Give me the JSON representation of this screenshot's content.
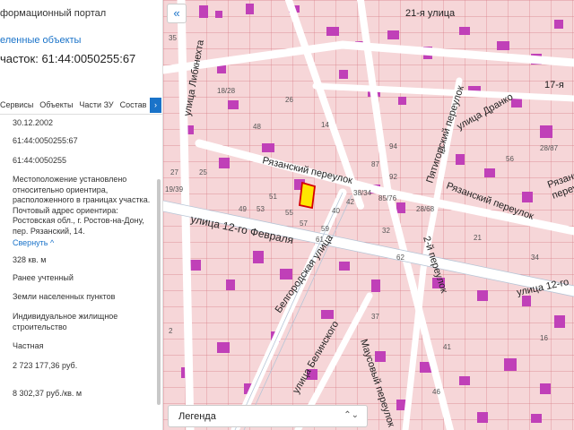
{
  "panel": {
    "portal_title": "формационный портал",
    "back_link": "еленные объекты",
    "parcel_title": "часток: 61:44:0050255:67",
    "tabs": [
      "Сервисы",
      "Объекты",
      "Части ЗУ",
      "Состав"
    ],
    "tab_more": "›",
    "properties": [
      "30.12.2002",
      "61:44:0050255:67",
      "61:44:0050255",
      "Местоположение установлено относительно ориентира, расположенного в границах участка. Почтовый адрес ориентира: Ростовская обл., г. Ростов-на-Дону, пер. Рязанский, 14.",
      "328 кв. м",
      "Ранее учтенный",
      "Земли населенных пунктов",
      "Индивидуальное жилищное строительство",
      "Частная",
      "2 723 177,36 руб.",
      "8 302,37 руб./кв. м"
    ],
    "collapse_label": "Свернуть",
    "collapse_chevron": "^"
  },
  "map": {
    "collapse_button": "«",
    "legend_label": "Легенда",
    "legend_chevron": "⌃⌄",
    "colors": {
      "background": "#f5e6e6",
      "parcel_fill": "#f8c9cc",
      "parcel_border": "#d85a6a",
      "building": "#c040b8",
      "road": "#ffffff",
      "road_edge": "#b7c5d6",
      "selected_fill": "#ffe600",
      "selected_border": "#d40000",
      "block_border": "#8fa3bd"
    },
    "street_labels": [
      "21-я улица",
      "улица Либкнехта",
      "улица Дранко",
      "Пятигорский переулок",
      "Рязанский переулок",
      "Рязанский переулок",
      "улица 12-го Февраля",
      "улица 12-го",
      "Белгородская улица",
      "2-й переулок",
      "улица Белинского",
      "Маусовый переулок",
      "17-я",
      "Рязанский",
      "переулок"
    ],
    "parcel_numbers": [
      "35",
      "25",
      "27",
      "19/39",
      "53",
      "55",
      "57",
      "59",
      "40",
      "42",
      "61",
      "38/34",
      "51",
      "49",
      "28/68",
      "85/76",
      "94",
      "54",
      "56",
      "28/87",
      "87",
      "92",
      "32",
      "62",
      "18/28",
      "2",
      "41",
      "16",
      "46",
      "37",
      "21",
      "34",
      "48",
      "26",
      "14"
    ]
  }
}
